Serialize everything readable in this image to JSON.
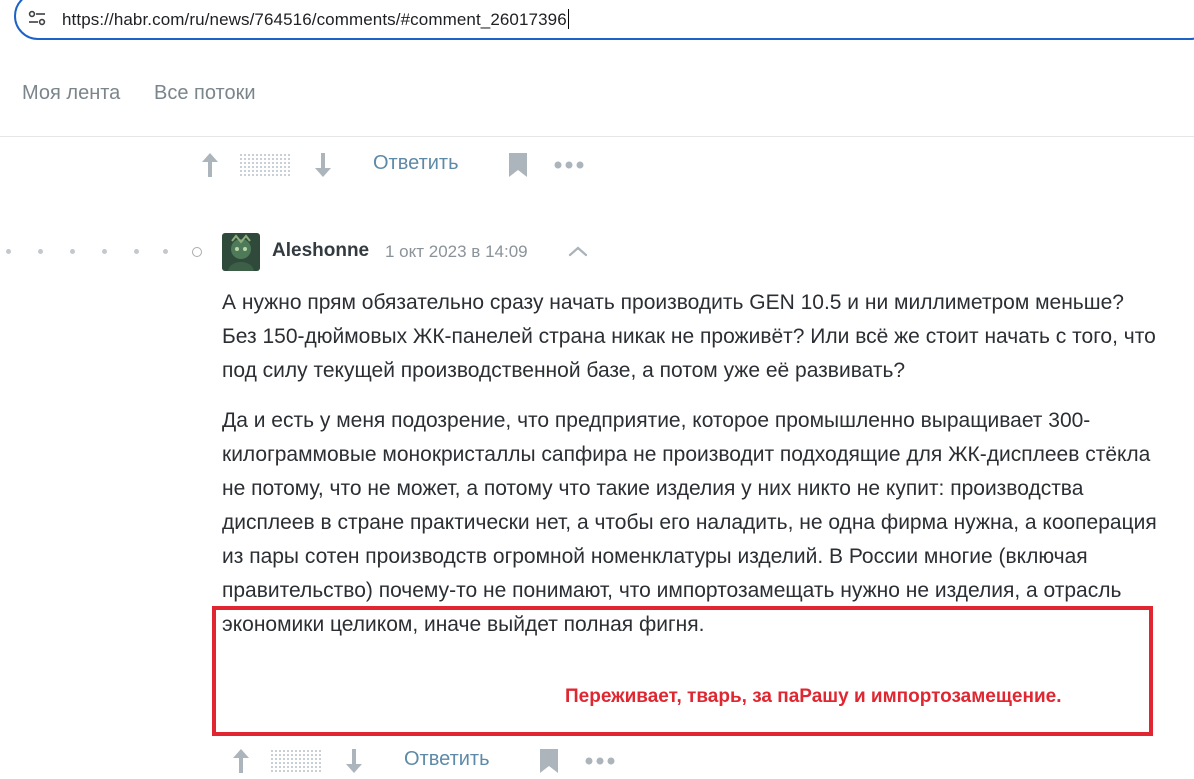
{
  "browser": {
    "url": "https://habr.com/ru/news/764516/comments/#comment_26017396",
    "site_info_icon": "tune-icon",
    "accent_color": "#1d62c8"
  },
  "nav": {
    "items": [
      {
        "label": "Моя лента"
      },
      {
        "label": "Все потоки"
      }
    ]
  },
  "prev_comment_actions": {
    "reply_label": "Ответить",
    "icons": [
      "arrow-up-icon",
      "rating-placeholder-icon",
      "arrow-down-icon",
      "bookmark-icon",
      "more-icon"
    ]
  },
  "comment": {
    "author": "Aleshonne",
    "date": "1 окт 2023 в 14:09",
    "paragraphs": [
      "А нужно прям обязательно сразу начать производить GEN 10.5 и ни миллиметром меньше? Без 150-дюймовых ЖК-панелей страна никак не проживёт? Или всё же стоит начать с того, что под силу текущей производственной базе, а потом уже её развивать?",
      "Да и есть у меня подозрение, что предприятие, которое промышленно выращивает 300-килограммовые монокристаллы сапфира не производит подходящие для ЖК-дисплеев стёкла не потому, что не может, а потому что такие изделия у них никто не купит: производства дисплеев в стране практически нет, а чтобы его наладить, не одна фирма нужна, а кооперация из пары сотен производств огромной номенклатуры изделий. В России многие (включая правительство) почему-то не понимают, что импортозамещать нужно не изделия, а отрасль экономики целиком, иначе выйдет полная фигня."
    ],
    "reply_label": "Ответить"
  },
  "annotation": {
    "text": "Переживает, тварь, за паРашу и импортозамещение.",
    "color": "#e02731"
  }
}
